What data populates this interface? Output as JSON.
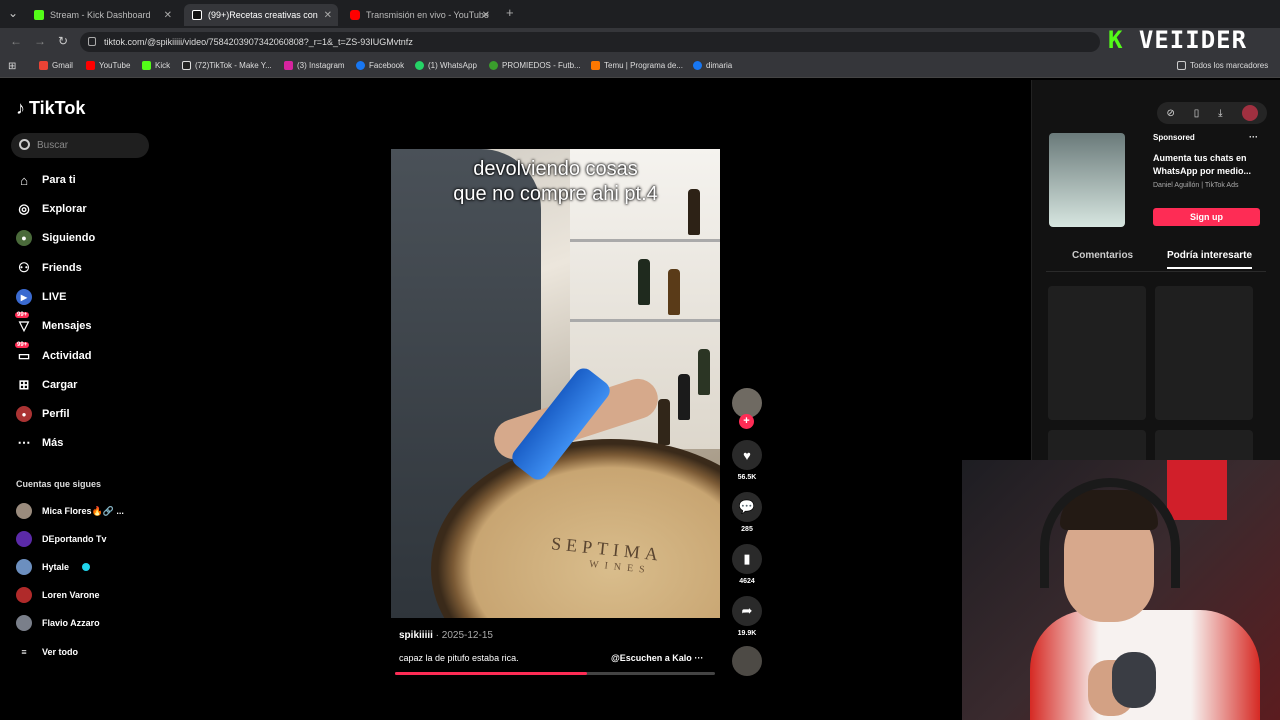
{
  "browser": {
    "tabs": [
      {
        "title": "Stream - Kick Dashboard",
        "color": "#53fc18"
      },
      {
        "title": "(99+)Recetas creativas con",
        "color": "#ffffff"
      },
      {
        "title": "Transmisión en vivo - YouTube",
        "color": "#ff0000"
      }
    ],
    "new_tab": "+",
    "url": "tiktok.com/@spikiiiii/video/7584203907342060808?_r=1&_t=ZS-93IUGMvtnfz",
    "bookmarks": [
      "Gmail",
      "YouTube",
      "Kick",
      "(72)TikTok - Make Y...",
      "(3) Instagram",
      "Facebook",
      "(1) WhatsApp",
      "PROMIEDOS - Futb...",
      "Temu | Programa de...",
      "dimaria"
    ],
    "all_bookmarks": "Todos los marcadores",
    "overlay_logo": {
      "left": "K",
      "right": "VEIIDER"
    }
  },
  "sidebar": {
    "logo": "TikTok",
    "search_placeholder": "Buscar",
    "nav": [
      {
        "label": "Para ti",
        "icon": "home-icon"
      },
      {
        "label": "Explorar",
        "icon": "compass-icon"
      },
      {
        "label": "Siguiendo",
        "icon": "following-icon"
      },
      {
        "label": "Friends",
        "icon": "friends-icon"
      },
      {
        "label": "LIVE",
        "icon": "live-icon"
      },
      {
        "label": "Mensajes",
        "icon": "messages-icon",
        "badge": "99+"
      },
      {
        "label": "Actividad",
        "icon": "activity-icon",
        "badge": "99+"
      },
      {
        "label": "Cargar",
        "icon": "upload-icon"
      },
      {
        "label": "Perfil",
        "icon": "profile-icon"
      },
      {
        "label": "Más",
        "icon": "more-icon"
      }
    ],
    "following_title": "Cuentas que sigues",
    "accounts": [
      "Mica Flores🔥🔗 ...",
      "DEportando Tv",
      "Hytale",
      "Loren Varone",
      "Flavio Azzaro"
    ],
    "see_all": "Ver todo"
  },
  "video": {
    "overlay_line1": "devolviendo cosas",
    "overlay_line2": "que no compre ahi pt.4",
    "barrel_text": "SEPTIMA",
    "barrel_sub": "WINES",
    "username": "spikiiiii",
    "date": " · 2025-12-15",
    "caption": "capaz la de pitufo estaba rica.",
    "sound": "@Escuchen a Kalo",
    "sound_more": "···",
    "progress": 0.6
  },
  "actions": {
    "likes": "56.5K",
    "comments": "285",
    "saves": "4624",
    "shares": "19.9K"
  },
  "right_panel": {
    "sponsored": "Sponsored",
    "ad_menu": "···",
    "ad_text": "Aumenta tus chats en WhatsApp por medio...",
    "ad_by": "Daniel Aguillón | TikTok Ads",
    "signup": "Sign up",
    "tab_comments": "Comentarios",
    "tab_interest": "Podría interesarte"
  },
  "colors": {
    "accent": "#fe2c55",
    "kick": "#53fc18"
  }
}
